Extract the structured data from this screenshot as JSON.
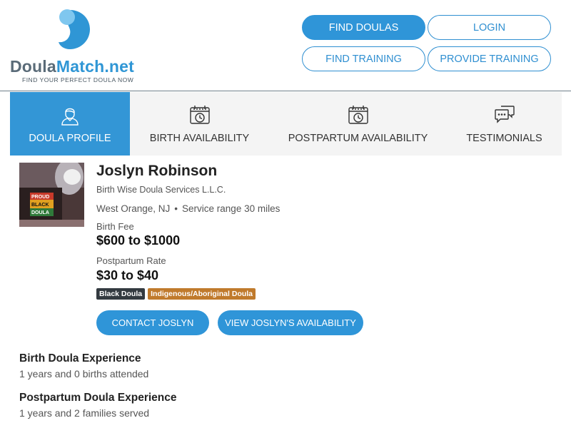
{
  "header": {
    "logo_main": "Doula",
    "logo_accent": "Match.net",
    "tagline": "FIND YOUR PERFECT DOULA NOW",
    "buttons": {
      "find_doulas": "FIND DOULAS",
      "login": "LOGIN",
      "find_training": "FIND TRAINING",
      "provide_training": "PROVIDE TRAINING"
    }
  },
  "tabs": [
    {
      "label": "DOULA PROFILE",
      "icon": "doula-person-icon",
      "active": true
    },
    {
      "label": "BIRTH AVAILABILITY",
      "icon": "calendar-clock-icon",
      "active": false
    },
    {
      "label": "POSTPARTUM AVAILABILITY",
      "icon": "calendar-clock-icon",
      "active": false
    },
    {
      "label": "TESTIMONIALS",
      "icon": "chat-bubbles-icon",
      "active": false
    }
  ],
  "profile": {
    "name": "Joslyn Robinson",
    "company": "Birth Wise Doula Services L.L.C.",
    "location": "West Orange, NJ",
    "separator": "•",
    "service_range": "Service range 30 miles",
    "birth_fee_label": "Birth Fee",
    "birth_fee": "$600 to $1000",
    "postpartum_label": "Postpartum Rate",
    "postpartum_rate": "$30 to $40",
    "badges": [
      {
        "text": "Black Doula",
        "color": "#333a40"
      },
      {
        "text": "Indigenous/Aboriginal Doula",
        "color": "#c07a2c"
      }
    ],
    "contact_button": "CONTACT JOSLYN",
    "availability_button": "VIEW JOSLYN'S AVAILABILITY",
    "photo_text": [
      "PROUD",
      "BLACK",
      "DOULA"
    ]
  },
  "experience": [
    {
      "heading": "Birth Doula Experience",
      "text": "1 years and 0 births attended"
    },
    {
      "heading": "Postpartum Doula Experience",
      "text": "1 years and 2 families served"
    }
  ],
  "colors": {
    "primary": "#2f95d8",
    "header_rule": "#6f7f8a",
    "tab_bg": "#f4f4f4"
  }
}
